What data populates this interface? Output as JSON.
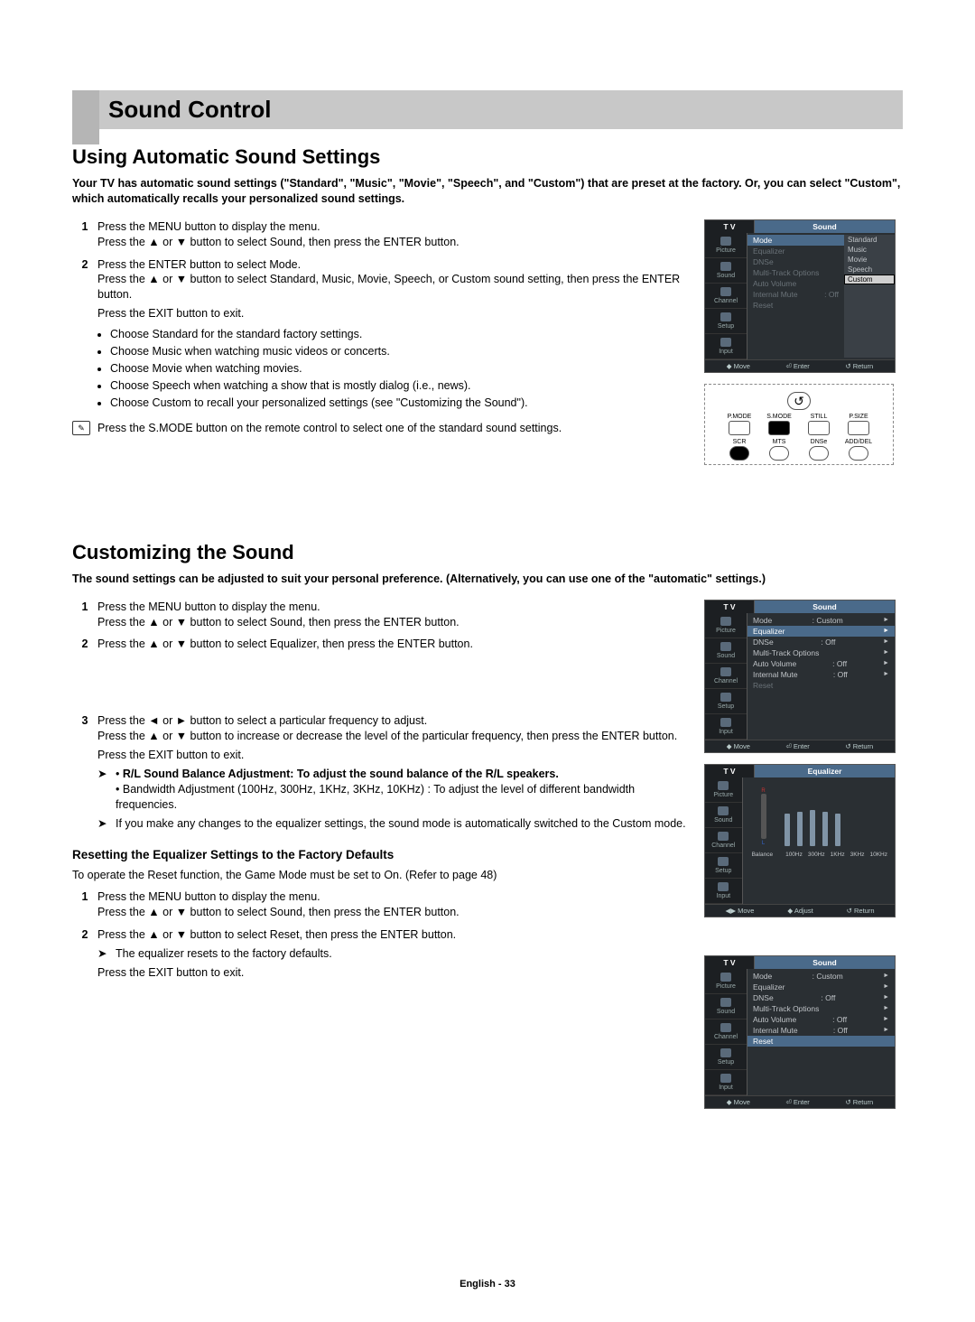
{
  "title": "Sound Control",
  "section1": {
    "heading": "Using Automatic Sound Settings",
    "intro": "Your TV has automatic sound settings (\"Standard\", \"Music\", \"Movie\", \"Speech\", and \"Custom\") that are preset at the factory. Or, you can select \"Custom\", which automatically recalls your personalized sound settings.",
    "steps": {
      "s1": "Press the MENU button to display the menu.\nPress the ▲ or ▼ button to select Sound, then press the ENTER button.",
      "s2": "Press the ENTER button to select Mode.\nPress the ▲ or ▼ button to select Standard, Music, Movie, Speech, or Custom sound setting, then press the ENTER button.",
      "s2exit": "Press the EXIT button to exit.",
      "bullets": [
        "Choose Standard for the standard factory settings.",
        "Choose Music when watching music videos or concerts.",
        "Choose Movie when watching movies.",
        "Choose Speech when watching a show that is mostly dialog (i.e., news).",
        "Choose Custom to recall your personalized settings (see \"Customizing the Sound\")."
      ]
    },
    "note": "Press the S.MODE button on the remote control to select one of the standard sound settings."
  },
  "section2": {
    "heading": "Customizing the Sound",
    "intro": "The sound settings can be adjusted to suit your personal preference. (Alternatively, you can use one of the \"automatic\" settings.)",
    "steps": {
      "s1": "Press the MENU button to display the menu.\nPress the ▲ or ▼ button to select Sound, then press the ENTER button.",
      "s2": "Press the ▲ or ▼ button to select Equalizer, then press the ENTER button.",
      "s3a": "Press the ◄ or ► button to select a particular frequency to adjust.\nPress the ▲ or ▼ button to increase or decrease the level of the particular frequency, then press the ENTER button.",
      "s3exit": "Press the EXIT button to exit.",
      "arrow1a": "R/L Sound Balance Adjustment: To adjust the sound balance of the R/L speakers.",
      "arrow1b": "Bandwidth Adjustment (100Hz, 300Hz, 1KHz, 3KHz, 10KHz) : To adjust the level of different bandwidth frequencies.",
      "arrow2": "If you make any changes to the equalizer settings, the sound mode is automatically switched to the Custom mode."
    },
    "reset": {
      "subheading": "Resetting the Equalizer Settings to the Factory Defaults",
      "subintro": "To operate the Reset function, the Game Mode must be set to On. (Refer to page 48)",
      "s1": "Press the MENU button to display the menu.\nPress the ▲ or ▼ button to select Sound, then press the ENTER button.",
      "s2": "Press the ▲ or ▼ button to select Reset, then press the ENTER button.",
      "arrow": "The equalizer resets to the factory defaults.",
      "exit": "Press the EXIT button to exit."
    }
  },
  "osd": {
    "tv": "T V",
    "header_sound": "Sound",
    "header_eq": "Equalizer",
    "sidebar": [
      "Picture",
      "Sound",
      "Channel",
      "Setup",
      "Input"
    ],
    "mode_list": [
      "Standard",
      "Music",
      "Movie",
      "Speech",
      "Custom"
    ],
    "sound_menu": {
      "Mode": "",
      "Equalizer": "",
      "DNSe": "",
      "Multi-Track Options": "",
      "Auto Volume": "",
      "Internal Mute": ": Off",
      "Reset": ""
    },
    "sound_menu2": {
      "Mode": ": Custom",
      "Equalizer": "",
      "DNSe": ": Off",
      "Multi-Track Options": "",
      "Auto Volume": ": Off",
      "Internal Mute": ": Off",
      "Reset": ""
    },
    "footer": {
      "move": "Move",
      "enter": "Enter",
      "return": "Return",
      "adjust": "Adjust"
    },
    "eq_balance_label": "Balance",
    "eq_labels": [
      "100Hz",
      "300Hz",
      "1KHz",
      "3KHz",
      "10KHz"
    ]
  },
  "remote": {
    "row1": [
      "P.MODE",
      "S.MODE",
      "STILL",
      "P.SIZE"
    ],
    "row2": [
      "SCR",
      "MTS",
      "DNSe",
      "ADD/DEL"
    ]
  },
  "footer": "English - 33"
}
